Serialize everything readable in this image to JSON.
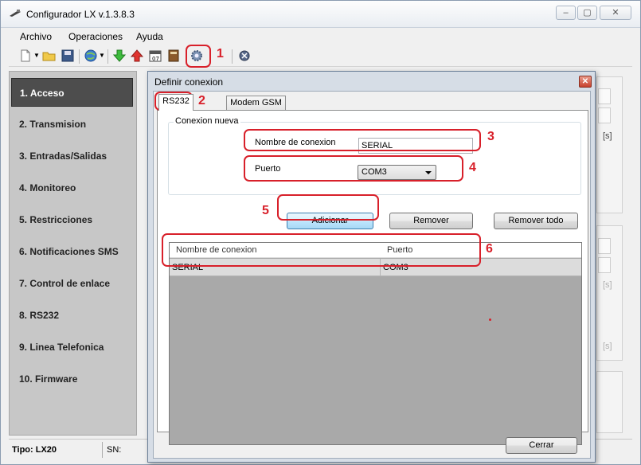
{
  "window": {
    "title": "Configurador LX v.1.3.8.3"
  },
  "menu": [
    "Archivo",
    "Operaciones",
    "Ayuda"
  ],
  "toolbar": [
    "new-icon",
    "open-folder-icon",
    "save-icon",
    "globe-icon",
    "download-arrow-icon",
    "upload-arrow-icon",
    "calendar-icon",
    "book-icon",
    "settings-gear-icon",
    "disconnect-icon"
  ],
  "annotations": [
    "1",
    "2",
    "3",
    "4",
    "5",
    "6"
  ],
  "sidebar": {
    "items": [
      "1. Acceso",
      "2. Transmision",
      "3. Entradas/Salidas",
      "4. Monitoreo",
      "5. Restricciones",
      "6. Notificaciones SMS",
      "7. Control de enlace",
      "8. RS232",
      "9. Linea Telefonica",
      "10. Firmware"
    ],
    "active_index": 0
  },
  "status": {
    "tipo": "Tipo: LX20",
    "sn": "SN:"
  },
  "background": {
    "unit_1": "[s]",
    "unit_2": "[s]",
    "unit_3": "[s]"
  },
  "dialog": {
    "title": "Definir conexion",
    "tabs": [
      "RS232",
      "Modem GSM"
    ],
    "group_title": "Conexion nueva",
    "name_label": "Nombre de conexion",
    "name_value": "SERIAL",
    "port_label": "Puerto",
    "port_value": "COM3",
    "buttons": {
      "add": "Adicionar",
      "remove": "Remover",
      "remove_all": "Remover todo",
      "close": "Cerrar"
    },
    "table": {
      "columns": [
        "Nombre de conexion",
        "Puerto"
      ],
      "rows": [
        [
          "SERIAL",
          "COM3"
        ]
      ]
    }
  },
  "colors": {
    "annotation": "#d8202a",
    "sidebar_active": "#4d4d4d",
    "grid_bg": "#a9a9a9"
  }
}
